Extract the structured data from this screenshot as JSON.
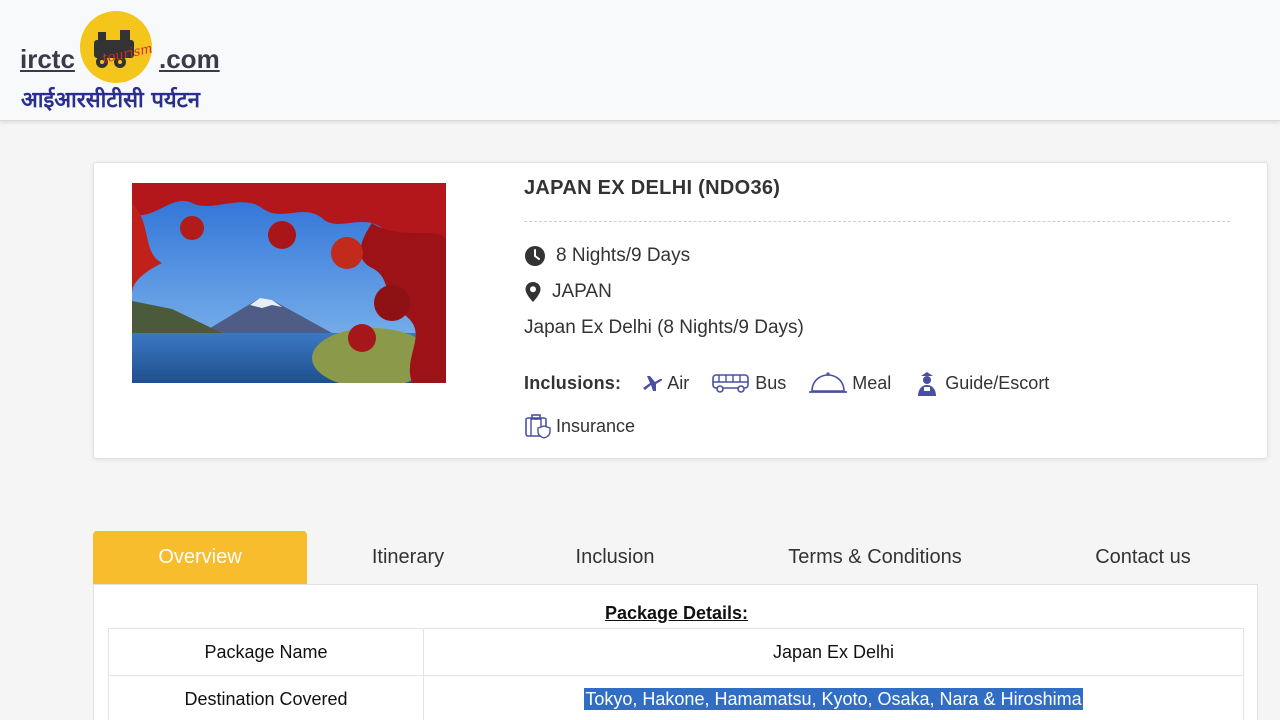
{
  "header": {
    "logo_prefix": "irctc",
    "logo_suffix": ".com",
    "logo_badge_text": "tourism",
    "logo_hindi": "आईआरसीटीसी पर्यटन"
  },
  "package": {
    "title": "JAPAN EX DELHI (NDO36)",
    "duration": "8 Nights/9 Days",
    "location": "JAPAN",
    "subtitle": "Japan Ex Delhi (8 Nights/9 Days)",
    "inclusions_label": "Inclusions:",
    "inclusions": [
      {
        "label": "Air",
        "icon": "plane-icon"
      },
      {
        "label": "Bus",
        "icon": "bus-icon"
      },
      {
        "label": "Meal",
        "icon": "meal-cloche-icon"
      },
      {
        "label": "Guide/Escort",
        "icon": "guide-icon"
      },
      {
        "label": "Insurance",
        "icon": "insurance-icon"
      }
    ]
  },
  "tabs": [
    {
      "label": "Overview",
      "active": true
    },
    {
      "label": "Itinerary",
      "active": false
    },
    {
      "label": "Inclusion",
      "active": false
    },
    {
      "label": "Terms & Conditions",
      "active": false
    },
    {
      "label": "Contact us",
      "active": false
    }
  ],
  "details": {
    "title": "Package Details:",
    "rows": [
      {
        "key": "Package Name",
        "value": "Japan Ex Delhi"
      },
      {
        "key": "Destination Covered",
        "value": "Tokyo, Hakone, Hamamatsu, Kyoto, Osaka, Nara & Hiroshima"
      }
    ]
  },
  "colors": {
    "accent": "#f7bd2d",
    "brand_hindi": "#2a2f8f",
    "selection": "#2f6ec4"
  }
}
